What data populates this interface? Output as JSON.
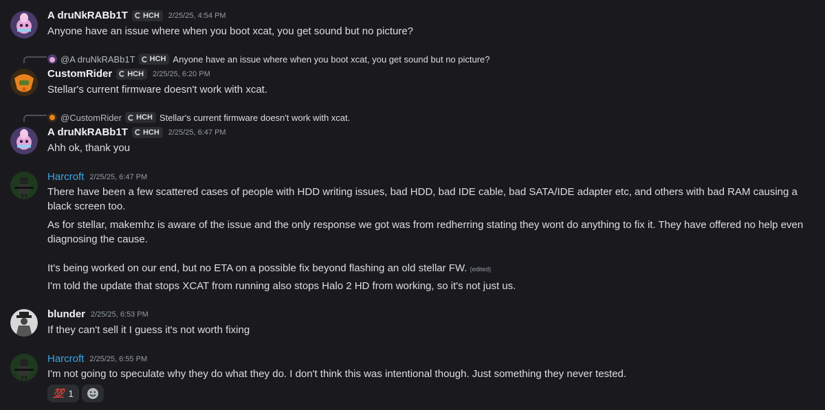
{
  "messages": [
    {
      "author": "A druNkRABb1T",
      "tag": "HCH",
      "time": "2/25/25, 4:54 PM",
      "text": "Anyone have an issue where when you boot xcat, you get sound but no picture?"
    },
    {
      "reply": {
        "author": "@A druNkRABb1T",
        "tag": "HCH",
        "text": "Anyone have an issue where when you boot xcat, you get sound but no picture?"
      },
      "author": "CustomRider",
      "tag": "HCH",
      "time": "2/25/25, 6:20 PM",
      "text": "Stellar's current firmware doesn't work with xcat."
    },
    {
      "reply": {
        "author": "@CustomRider",
        "tag": "HCH",
        "text": "Stellar's current firmware doesn't work with xcat."
      },
      "author": "A druNkRABb1T",
      "tag": "HCH",
      "time": "2/25/25, 6:47 PM",
      "text": "Ahh ok, thank you"
    },
    {
      "author": "Harcroft",
      "time": "2/25/25, 6:47 PM",
      "lines": [
        "There have been a few scattered cases of people with HDD writing issues, bad HDD, bad IDE cable, bad SATA/IDE adapter etc, and others with bad RAM causing a black screen too.",
        "As for stellar, makemhz is aware of the issue and the only response we got was from redherring stating they wont do anything to fix it. They have offered no help even diagnosing the cause.",
        "It's being worked on our end, but no ETA on a possible fix beyond flashing an old stellar FW.",
        "I'm told the update that stops XCAT from running also stops Halo 2 HD from working, so it's not just us."
      ],
      "edited": "(edited)"
    },
    {
      "author": "blunder",
      "time": "2/25/25, 6:53 PM",
      "text": "If they can't sell it I guess it's not worth fixing"
    },
    {
      "author": "Harcroft",
      "time": "2/25/25, 6:55 PM",
      "text": "I'm not going to speculate why they do what they do. I don't think this was intentional though. Just something they never tested.",
      "reactions": [
        {
          "emoji": "💯",
          "count": "1"
        }
      ]
    }
  ],
  "colors": {
    "background": "#1a1a1e",
    "harcroft_name": "#3ba6e8",
    "hundred": "#e8354a"
  }
}
